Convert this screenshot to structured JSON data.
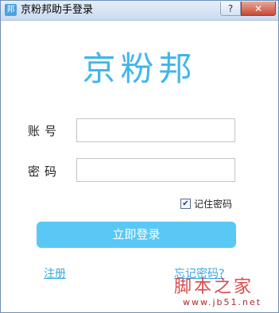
{
  "window": {
    "title": "京粉邦助手登录",
    "app_icon_glyph": "邦",
    "help_glyph": "?",
    "close_glyph": "✕"
  },
  "logo": {
    "text": "京粉邦"
  },
  "form": {
    "account_label": "账号",
    "account_value": "",
    "password_label": "密码",
    "password_value": "",
    "remember_label": "记住密码",
    "remember_checked": true,
    "remember_glyph": "✔"
  },
  "actions": {
    "login_label": "立即登录",
    "register_label": "注册",
    "forgot_label": "忘记密码?"
  },
  "watermark": {
    "main": "脚本之家",
    "url": "www.jb51.net"
  },
  "colors": {
    "brand": "#3fb6ea",
    "button": "#5ac8f5",
    "link": "#3aa7de",
    "watermark": "#d8393b"
  }
}
